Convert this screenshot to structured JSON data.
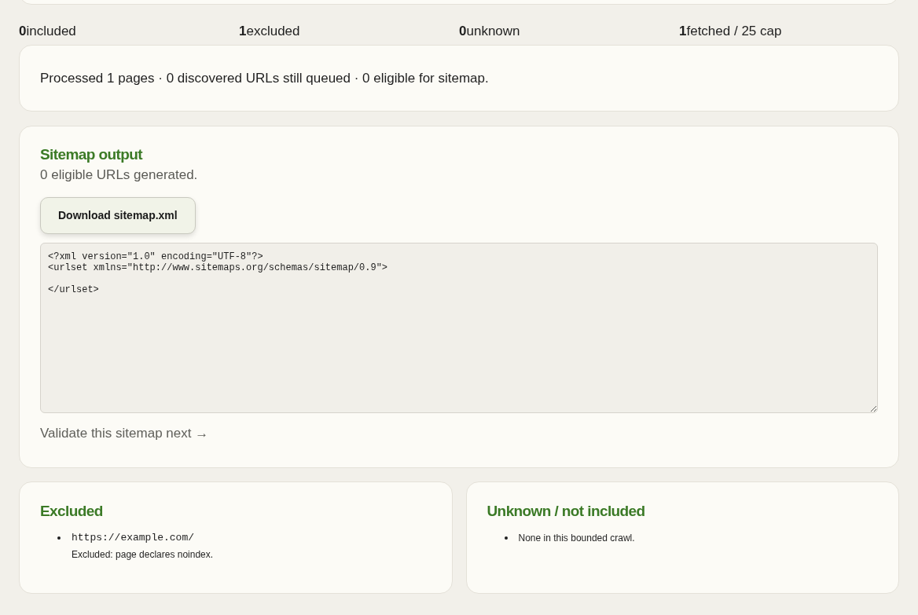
{
  "stats": [
    {
      "value": "0",
      "label": "included"
    },
    {
      "value": "1",
      "label": "excluded"
    },
    {
      "value": "0",
      "label": "unknown"
    },
    {
      "value": "1",
      "label": "fetched / 25 cap"
    }
  ],
  "summary": "Processed 1 pages · 0 discovered URLs still queued · 0 eligible for sitemap.",
  "sitemap_output": {
    "title": "Sitemap output",
    "subtitle": "0 eligible URLs generated.",
    "download_button": "Download sitemap.xml",
    "xml": "<?xml version=\"1.0\" encoding=\"UTF-8\"?>\n<urlset xmlns=\"http://www.sitemaps.org/schemas/sitemap/0.9\">\n\n</urlset>",
    "next_link": "Validate this sitemap next →"
  },
  "excluded": {
    "title": "Excluded",
    "items": [
      {
        "kind": "url",
        "url": "https://example.com/",
        "reason": "Excluded: page declares noindex."
      }
    ]
  },
  "unknown": {
    "title": "Unknown / not included",
    "items": [
      {
        "kind": "note",
        "text": "None in this bounded crawl."
      }
    ]
  }
}
